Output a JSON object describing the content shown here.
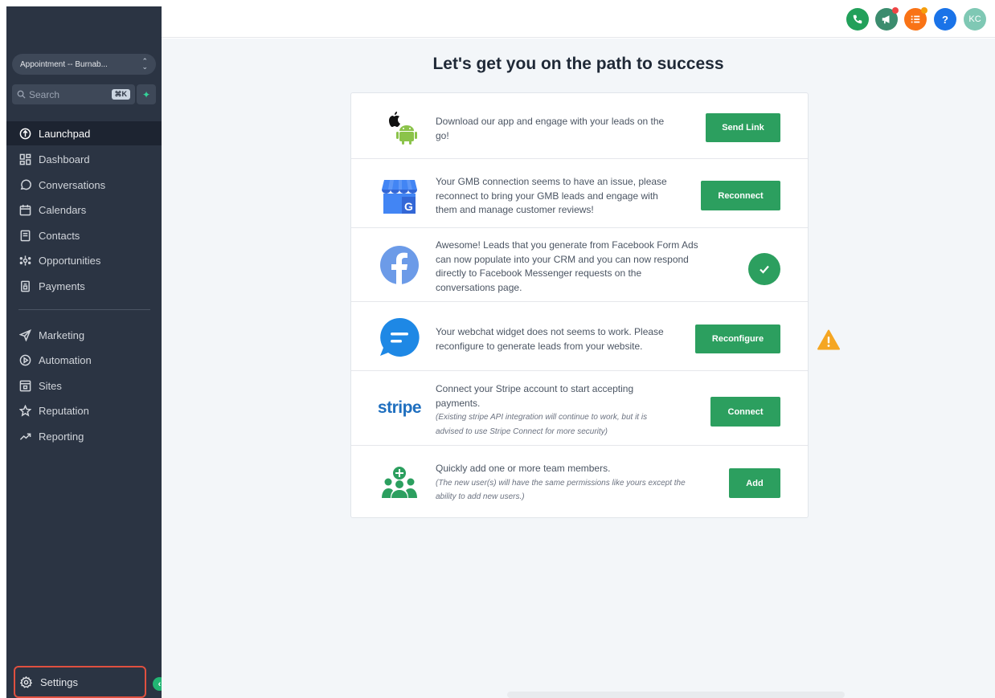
{
  "sidebar": {
    "location": "Appointment -- Burnab...",
    "search": {
      "placeholder": "Search",
      "shortcut": "⌘K"
    },
    "items_primary": [
      {
        "label": "Launchpad",
        "icon": "launchpad-icon",
        "active": true
      },
      {
        "label": "Dashboard",
        "icon": "dashboard-icon"
      },
      {
        "label": "Conversations",
        "icon": "chat-bubble-icon"
      },
      {
        "label": "Calendars",
        "icon": "calendar-icon"
      },
      {
        "label": "Contacts",
        "icon": "contacts-icon"
      },
      {
        "label": "Opportunities",
        "icon": "opportunities-icon"
      },
      {
        "label": "Payments",
        "icon": "payments-icon"
      }
    ],
    "items_secondary": [
      {
        "label": "Marketing",
        "icon": "send-icon"
      },
      {
        "label": "Automation",
        "icon": "automation-icon"
      },
      {
        "label": "Sites",
        "icon": "sites-icon"
      },
      {
        "label": "Reputation",
        "icon": "star-icon"
      },
      {
        "label": "Reporting",
        "icon": "trend-icon"
      }
    ],
    "settings_label": "Settings"
  },
  "topbar": {
    "icons": [
      {
        "name": "phone-icon",
        "color": "#22a05a"
      },
      {
        "name": "megaphone-icon",
        "color": "#3b8c6e"
      },
      {
        "name": "task-list-icon",
        "color": "#f97316"
      },
      {
        "name": "help-icon",
        "color": "#1a73e8",
        "glyph": "?"
      },
      {
        "name": "user-avatar",
        "color": "#7fc8b4",
        "glyph": "KC"
      }
    ]
  },
  "main": {
    "title": "Let's get you on the path to success",
    "rows": [
      {
        "id": "app",
        "text": "Download our app and engage with your leads on the go!",
        "button": "Send Link"
      },
      {
        "id": "gmb",
        "text": "Your GMB connection seems to have an issue, please reconnect to bring your GMB leads and engage with them and manage customer reviews!",
        "button": "Reconnect"
      },
      {
        "id": "facebook",
        "text": "Awesome! Leads that you generate from Facebook Form Ads can now populate into your CRM and you can now respond directly to Facebook Messenger requests on the conversations page.",
        "status": "connected"
      },
      {
        "id": "webchat",
        "text": "Your webchat widget does not seems to work. Please reconfigure to generate leads from your website.",
        "button": "Reconfigure",
        "warning": true
      },
      {
        "id": "stripe",
        "text": "Connect your Stripe account to start accepting payments.",
        "note": "(Existing stripe API integration will continue to work, but it is advised to use Stripe Connect for more security)",
        "button": "Connect",
        "logo_text": "stripe"
      },
      {
        "id": "team",
        "text": "Quickly add one or more team members.",
        "note": "(The new user(s) will have the same permissions like yours except the ability to add new users.)",
        "button": "Add"
      }
    ]
  },
  "colors": {
    "accent": "#2c9f5f",
    "sidebar": "#2b3443",
    "warning": "#f59e0b"
  }
}
